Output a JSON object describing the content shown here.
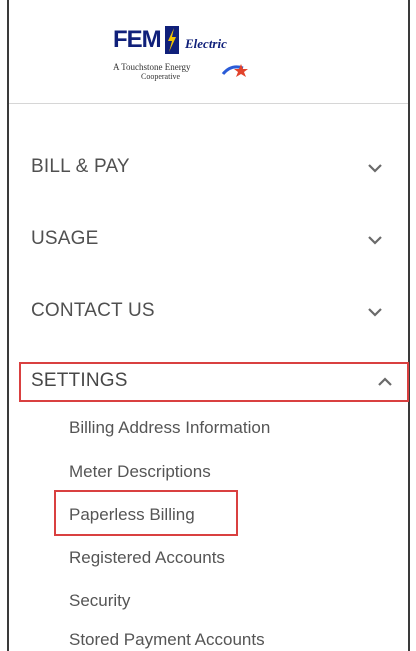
{
  "logo": {
    "brand": "FEM",
    "name": "Electric",
    "tagline_line1": "A Touchstone Energy",
    "tagline_line2": "Cooperative"
  },
  "menu": {
    "items": [
      {
        "label": "BILL & PAY",
        "icon": "chevron-down-icon"
      },
      {
        "label": "USAGE",
        "icon": "chevron-down-icon"
      },
      {
        "label": "CONTACT US",
        "icon": "chevron-down-icon"
      },
      {
        "label": "SETTINGS",
        "icon": "chevron-up-icon"
      }
    ],
    "settings_submenu": [
      "Billing Address Information",
      "Meter Descriptions",
      "Paperless Billing",
      "Registered Accounts",
      "Security",
      "Stored Payment Accounts"
    ]
  },
  "colors": {
    "highlight": "#d94040",
    "brand_blue": "#10207a",
    "text": "#505050"
  }
}
